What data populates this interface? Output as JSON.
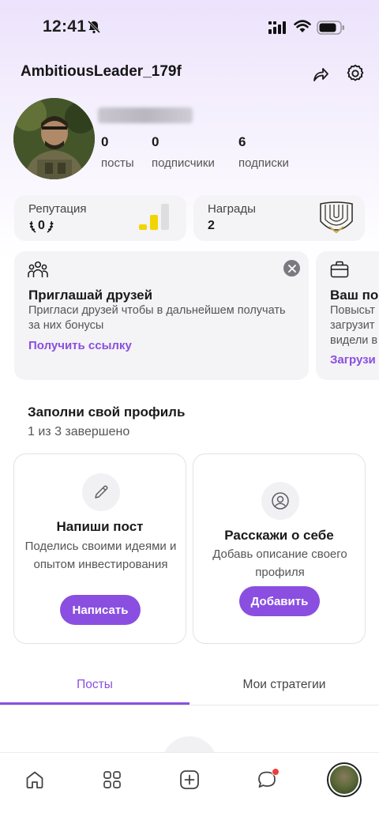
{
  "status_bar": {
    "time": "12:41"
  },
  "header": {
    "username": "AmbitiousLeader_179f"
  },
  "profile": {
    "stats": [
      {
        "value": "0",
        "label": "посты"
      },
      {
        "value": "0",
        "label": "подписчики"
      },
      {
        "value": "6",
        "label": "подписки"
      }
    ]
  },
  "reputation": {
    "title": "Репутация",
    "value": "0"
  },
  "awards": {
    "title": "Награды",
    "value": "2"
  },
  "promo_cards": [
    {
      "title": "Приглашай друзей",
      "desc": "Пригласи друзей чтобы в дальнейшем получать за них бонусы",
      "link": "Получить ссылку"
    },
    {
      "title": "Ваш по",
      "desc": "Повысьт загрузит видели в",
      "link": "Загрузи"
    }
  ],
  "fill_profile": {
    "title": "Заполни свой профиль",
    "progress": "1 из 3 завершено",
    "tasks": [
      {
        "title": "Напиши пост",
        "desc": "Поделись своими идеями и опытом инвестирования",
        "button": "Написать",
        "icon": "pencil-icon"
      },
      {
        "title": "Расскажи о себе",
        "desc": "Добавь описание своего профиля",
        "button": "Добавить",
        "icon": "user-icon"
      }
    ]
  },
  "tabs": [
    {
      "label": "Посты",
      "active": true
    },
    {
      "label": "Мои стратегии",
      "active": false
    }
  ],
  "bottom_nav": [
    "home-icon",
    "grid-icon",
    "add-icon",
    "chat-icon",
    "profile-avatar"
  ],
  "colors": {
    "accent": "#8a4fe0",
    "reputation_bar": "#f2d500",
    "notification": "#ef3d3d"
  }
}
